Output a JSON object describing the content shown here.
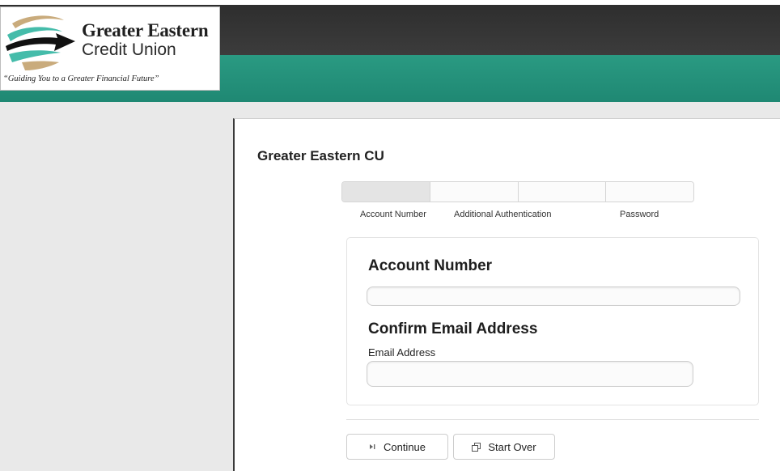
{
  "brand": {
    "name_line1": "Greater Eastern",
    "name_line2": "Credit Union",
    "tagline": "“Guiding You to a Greater Financial Future”",
    "colors": {
      "header_dark": "#333333",
      "header_teal": "#22907a",
      "logo_tan": "#c4a678",
      "logo_teal": "#3fb8a6"
    },
    "icon": "swoosh-arrow-logo-icon"
  },
  "page": {
    "title": "Greater Eastern CU"
  },
  "steps": {
    "items": [
      {
        "label": "Account Number",
        "active": true
      },
      {
        "label": "Additional Authentication",
        "active": false
      },
      {
        "label": "",
        "active": false
      },
      {
        "label": "Password",
        "active": false
      }
    ]
  },
  "form": {
    "account_heading": "Account Number",
    "account_value": "",
    "account_placeholder": "",
    "email_heading": "Confirm Email Address",
    "email_label": "Email Address",
    "email_value": "",
    "email_placeholder": ""
  },
  "actions": {
    "continue_label": "Continue",
    "continue_icon": "step-forward-icon",
    "start_over_label": "Start Over",
    "start_over_icon": "copy-pages-icon"
  }
}
